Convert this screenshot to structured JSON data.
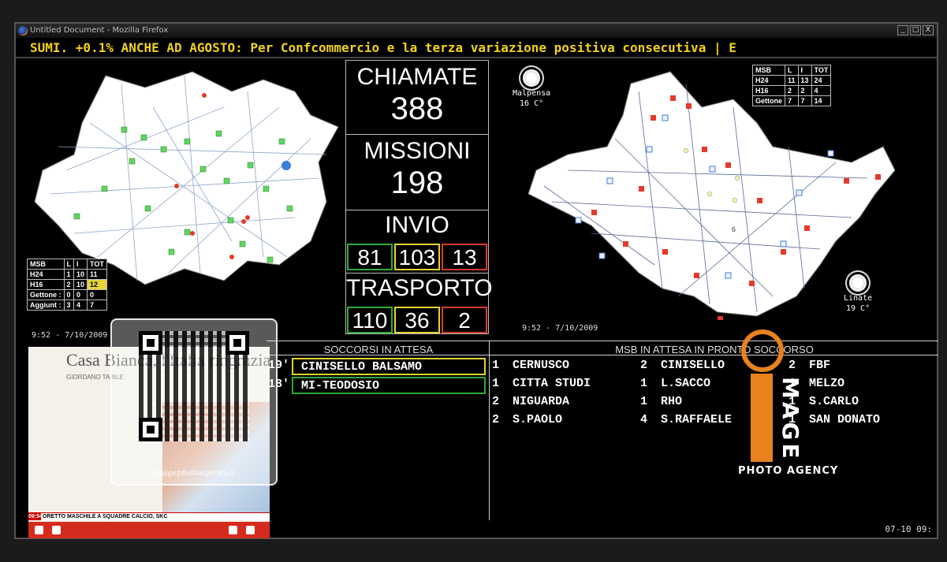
{
  "window": {
    "title": "Untitled Document - Mozilla Firefox",
    "buttons": [
      "_",
      "□",
      "X"
    ]
  },
  "ticker": {
    "text": "SUMI. +0.1% ANCHE AD AGOSTO: Per Confcommercio e  la terza variazione positiva consecutiva | E"
  },
  "left_map": {
    "timestamp": "9:52 - 7/10/2009",
    "legend": {
      "headers": [
        "MSB",
        "L",
        "I",
        "TOT"
      ],
      "rows": [
        [
          "H24",
          "1",
          "10",
          "11"
        ],
        [
          "H16",
          "2",
          "10",
          "12"
        ],
        [
          "Gettone :",
          "0",
          "0",
          "0"
        ],
        [
          "Aggiunt :",
          "3",
          "4",
          "7"
        ]
      ]
    }
  },
  "right_map": {
    "timestamp": "9:52 - 7/10/2009",
    "legend": {
      "headers": [
        "MSB",
        "L",
        "I",
        "TOT"
      ],
      "rows": [
        [
          "H24",
          "11",
          "13",
          "24"
        ],
        [
          "H16",
          "2",
          "2",
          "4"
        ],
        [
          "Gettone",
          "7",
          "7",
          "14"
        ]
      ]
    },
    "weather": [
      {
        "city": "Malpensa",
        "temp": "16 C°",
        "icon": "sun-icon"
      },
      {
        "city": "Linate",
        "temp": "19 C°",
        "icon": "sun-icon"
      }
    ],
    "zone_label": "6"
  },
  "stats": {
    "chiamate": {
      "label": "CHIAMATE",
      "value": "388"
    },
    "missioni": {
      "label": "MISSIONI",
      "value": "198"
    },
    "invio": {
      "label": "INVIO",
      "values": [
        "81",
        "103",
        "13"
      ]
    },
    "trasporto": {
      "label": "TRASPORTO",
      "values": [
        "110",
        "36",
        "2"
      ]
    }
  },
  "soccorsi": {
    "title": "SOCCORSI IN ATTESA",
    "rows": [
      {
        "minutes": "19'",
        "place": "CINISELLO BALSAMO",
        "color": "#e2d32b"
      },
      {
        "minutes": "18'",
        "place": "MI-TEODOSIO",
        "color": "#2eaa3a"
      }
    ]
  },
  "msb_attesa": {
    "title": "MSB IN ATTESA IN PRONTO SOCCORSO",
    "col1": [
      [
        "1",
        "CERNUSCO"
      ],
      [
        "1",
        "CITTA STUDI"
      ],
      [
        "2",
        "NIGUARDA"
      ],
      [
        "2",
        "S.PAOLO"
      ]
    ],
    "col2": [
      [
        "2",
        "CINISELLO"
      ],
      [
        "1",
        "L.SACCO"
      ],
      [
        "1",
        "RHO"
      ],
      [
        "4",
        "S.RAFFAELE"
      ]
    ],
    "col3": [
      [
        "2",
        "FBF"
      ],
      [
        "1",
        "MELZO"
      ],
      [
        "1",
        "S.CARLO"
      ],
      [
        "1",
        "SAN DONATO"
      ]
    ]
  },
  "inset": {
    "headline": "Casa Bianca, l'Italia ringrazia",
    "author": "GIORDANO TABILE",
    "ticker_time": "09:54",
    "ticker_text": "ORETTO MASCHILE A SQUADRE   CALCIO, SKC"
  },
  "qr": {
    "url": "imagephotoagency.it"
  },
  "watermark": {
    "word": "MAGE",
    "agency": "PHOTO AGENCY"
  },
  "clock": "07-10 09:",
  "colors": {
    "green": "#2eaa3a",
    "yellow": "#e2d32b",
    "red": "#d63b2b",
    "ticker": "#f2d21b",
    "brand": "#e8821e"
  }
}
